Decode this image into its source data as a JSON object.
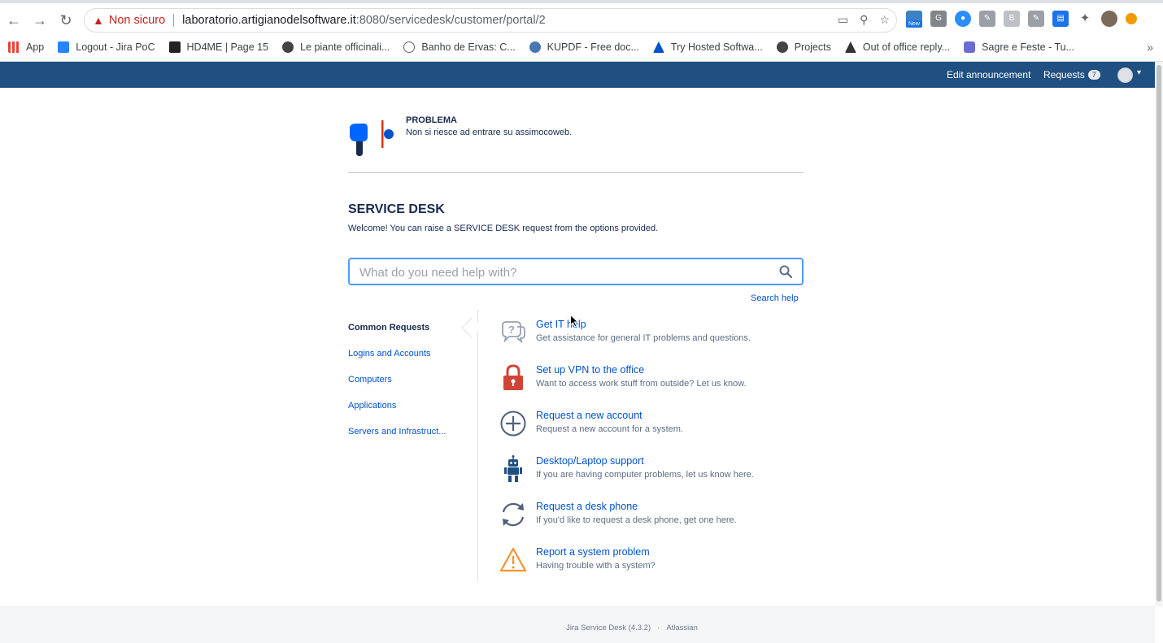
{
  "browser": {
    "insecure_label": "Non sicuro",
    "url_host": "laboratorio.artigianodelsoftware.it",
    "url_rest": ":8080/servicedesk/customer/portal/2",
    "ext_new_label": "New",
    "bookmarks": [
      "App",
      "Logout - Jira PoC",
      "HD4ME | Page 15",
      "Le piante officinali...",
      "Banho de Ervas: C...",
      "KUPDF - Free doc...",
      "Try Hosted Softwa...",
      "Projects",
      "Out of office reply...",
      "Sagre e Feste - Tu..."
    ]
  },
  "header": {
    "edit_announcement": "Edit announcement",
    "requests_label": "Requests",
    "requests_count": "7"
  },
  "announcement": {
    "title": "PROBLEMA",
    "text": "Non si riesce ad entrare su assimocoweb."
  },
  "portal": {
    "title": "SERVICE DESK",
    "welcome": "Welcome! You can raise a SERVICE DESK request from the options provided."
  },
  "search": {
    "placeholder": "What do you need help with?",
    "help_link": "Search help"
  },
  "groups": {
    "heading": "Common Requests",
    "items": [
      "Logins and Accounts",
      "Computers",
      "Applications",
      "Servers and Infrastruct..."
    ]
  },
  "request_types": [
    {
      "name": "Get IT help",
      "desc": "Get assistance for general IT problems and questions.",
      "icon": "question-bubble-icon"
    },
    {
      "name": "Set up VPN to the office",
      "desc": "Want to access work stuff from outside? Let us know.",
      "icon": "lock-icon"
    },
    {
      "name": "Request a new account",
      "desc": "Request a new account for a system.",
      "icon": "plus-circle-icon"
    },
    {
      "name": "Desktop/Laptop support",
      "desc": "If you are having computer problems, let us know here.",
      "icon": "robot-icon"
    },
    {
      "name": "Request a desk phone",
      "desc": "If you'd like to request a desk phone, get one here.",
      "icon": "refresh-icon"
    },
    {
      "name": "Report a system problem",
      "desc": "Having trouble with a system?",
      "icon": "warning-icon"
    }
  ],
  "footer": {
    "product": "Jira Service Desk (4.3.2)",
    "separator": "·",
    "vendor": "Atlassian"
  },
  "colors": {
    "header_bg": "#205081",
    "link": "#0052cc",
    "search_focus": "#4c9aff"
  }
}
